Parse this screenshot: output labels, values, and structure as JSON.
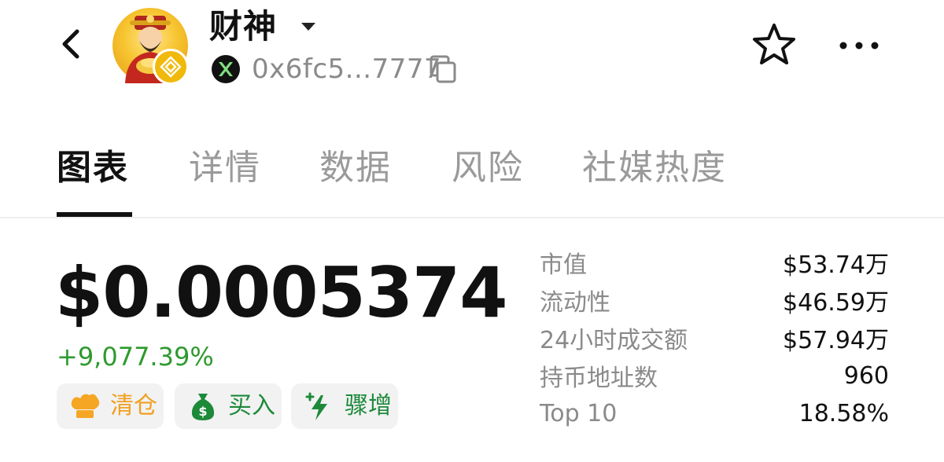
{
  "header": {
    "token_name": "财神",
    "address": "0x6fc5...7777",
    "icons": {
      "back": "chevron-left-icon",
      "dropdown": "caret-down-icon",
      "chain": "x-chain-icon",
      "copy": "copy-icon",
      "favorite": "star-icon",
      "more": "more-dots-icon",
      "badge": "bnb-badge-icon"
    }
  },
  "tabs": [
    {
      "label": "图表",
      "active": true
    },
    {
      "label": "详情",
      "active": false
    },
    {
      "label": "数据",
      "active": false
    },
    {
      "label": "风险",
      "active": false
    },
    {
      "label": "社媒热度",
      "active": false
    }
  ],
  "price": {
    "value": "$0.0005374",
    "change": "+9,077.39%"
  },
  "actions": [
    {
      "label": "清仓",
      "icon": "chef-hat-icon"
    },
    {
      "label": "买入",
      "icon": "money-bag-icon"
    },
    {
      "label": "骤增",
      "icon": "lightning-plus-icon"
    }
  ],
  "stats": [
    {
      "label": "市值",
      "value": "$53.74万"
    },
    {
      "label": "流动性",
      "value": "$46.59万"
    },
    {
      "label": "24小时成交额",
      "value": "$57.94万"
    },
    {
      "label": "持币地址数",
      "value": "960"
    },
    {
      "label": "Top 10",
      "value": "18.58%"
    }
  ],
  "colors": {
    "positive": "#2e9a2e",
    "clear_accent": "#f0a020",
    "buy_accent": "#1d8a3a",
    "muted_text": "#8a8a8a",
    "bnb_yellow": "#f0b90b"
  }
}
